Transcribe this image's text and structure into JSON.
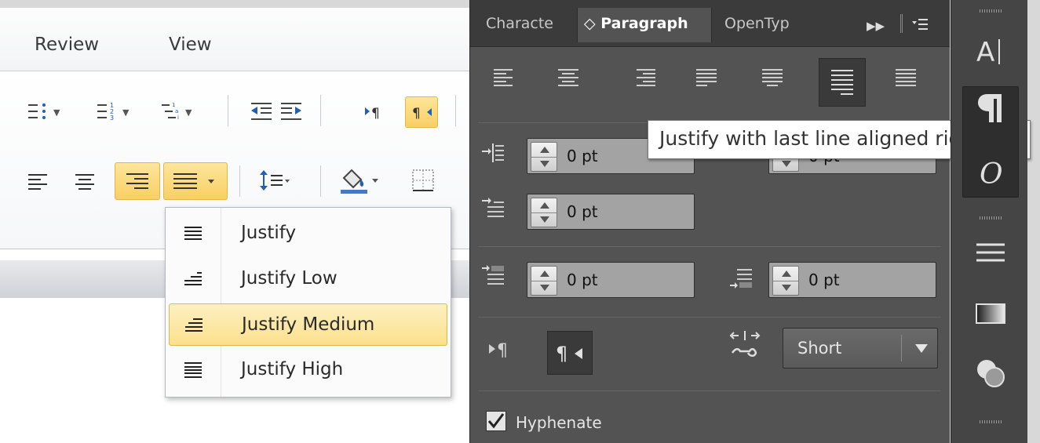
{
  "word": {
    "tabs": [
      "Review",
      "View"
    ],
    "justify_menu": {
      "items": [
        {
          "label": "Justify",
          "icon": "justify-icon",
          "active": false
        },
        {
          "label": "Justify Low",
          "icon": "justify-low-icon",
          "active": false
        },
        {
          "label": "Justify Medium",
          "icon": "justify-medium-icon",
          "active": true
        },
        {
          "label": "Justify High",
          "icon": "justify-high-icon",
          "active": false
        }
      ]
    },
    "colors": {
      "highlight": "#f9cf63",
      "highlight_border": "#e3b54a"
    }
  },
  "indesign": {
    "tabs": {
      "character": "Characte",
      "paragraph": "Paragraph",
      "opentype": "OpenTyp",
      "paragraph_glyph": "◇"
    },
    "indents": {
      "left_indent": "0 pt",
      "right_indent": "0 pt",
      "first_line_indent": "0 pt",
      "space_before": "0 pt",
      "space_after": "0 pt"
    },
    "kashida": {
      "label": "Short"
    },
    "hyphenate": {
      "label": "Hyphenate",
      "checked": true
    },
    "tooltip": "Justify with last line aligned right",
    "colors": {
      "panel_bg": "#535353",
      "tabbar_bg": "#3b3b3b",
      "field_bg": "#a3a3a3"
    }
  }
}
